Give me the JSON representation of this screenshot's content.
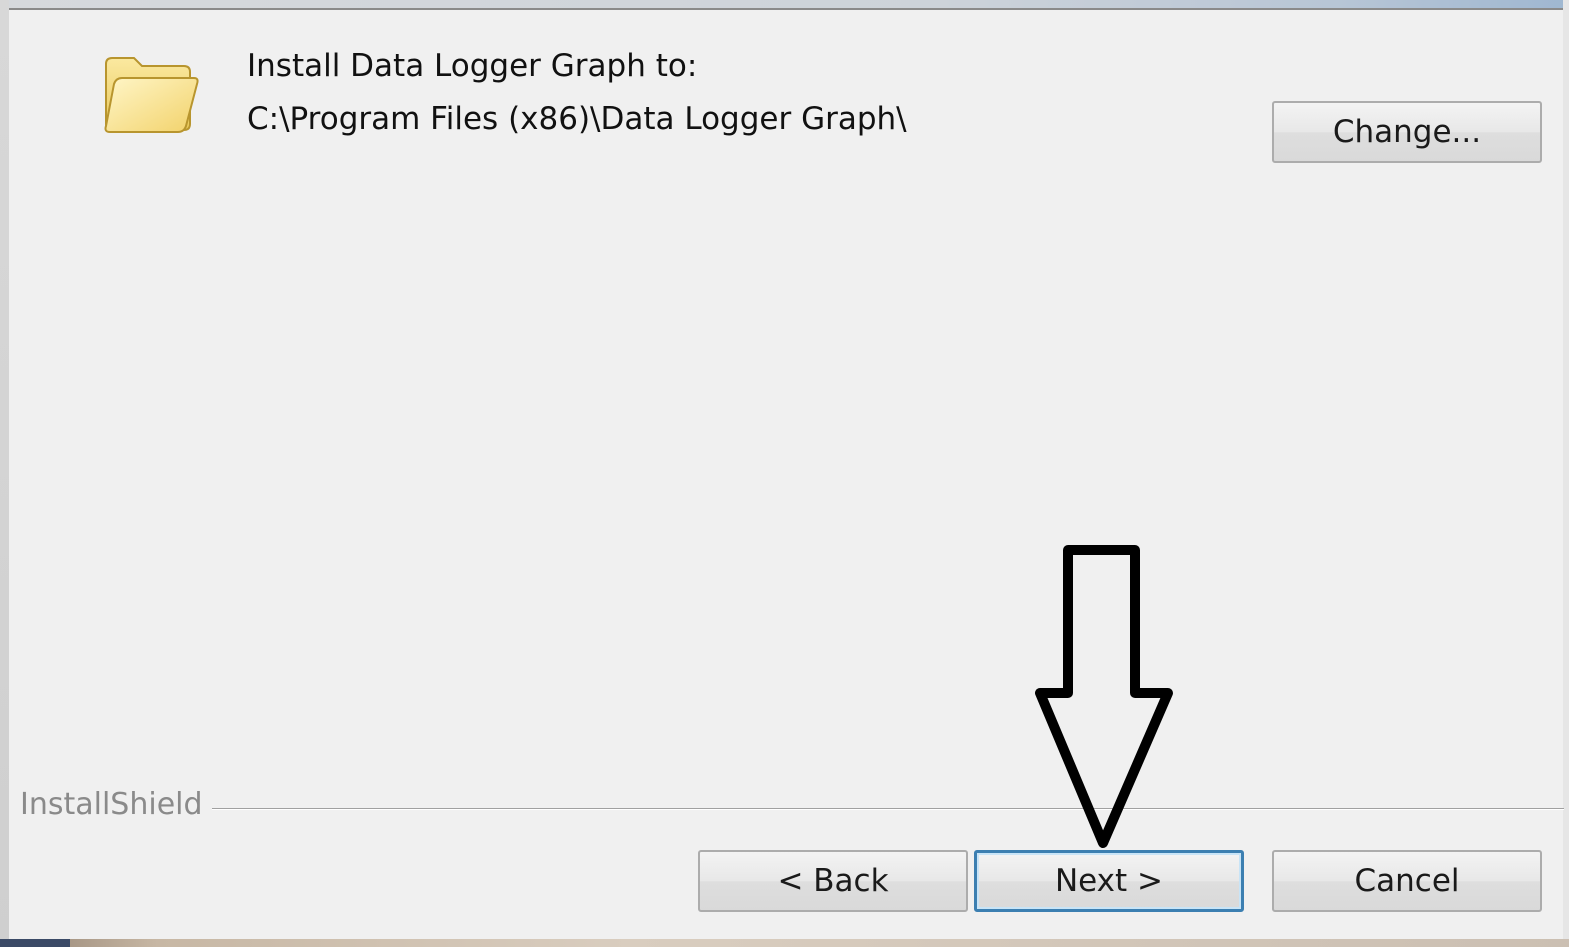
{
  "dialog": {
    "install_label": "Install Data Logger Graph to:",
    "install_path": "C:\\Program Files (x86)\\Data Logger Graph\\",
    "change_button_label": "Change...",
    "brand_label": "InstallShield",
    "back_button_label": "< Back",
    "next_button_label": "Next >",
    "cancel_button_label": "Cancel"
  },
  "icons": {
    "folder": "folder-icon",
    "annotation": "arrow-down-annotation"
  },
  "colors": {
    "background": "#f0f0f0",
    "default_button_border": "#3c7fb1",
    "folder_fill": "#f7df7a",
    "annotation_stroke": "#000000"
  }
}
